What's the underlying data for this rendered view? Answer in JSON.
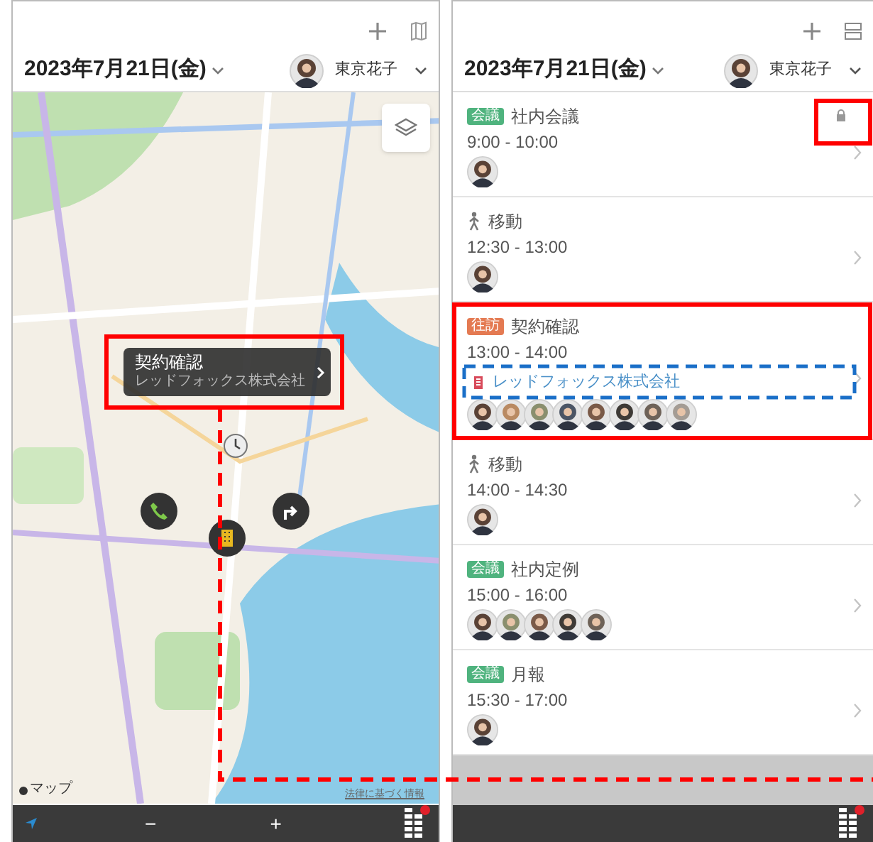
{
  "map_screen": {
    "date": "2023年7月21日(金)",
    "user": "東京花子",
    "map": {
      "kind": "picture",
      "callout": {
        "title": "契約確認",
        "subtitle": "レッドフォックス株式会社"
      },
      "attribution": "マップ",
      "legal_link": "法律に基づく情報"
    },
    "bottom_bar": {
      "zoom_out": "−",
      "zoom_in": "+",
      "notification": true
    }
  },
  "list_screen": {
    "date": "2023年7月21日(金)",
    "user": "東京花子",
    "events": [
      {
        "kind": "tagged",
        "tag": {
          "label": "会議",
          "color": "#4fb37e"
        },
        "title": "社内会議",
        "time": "9:00 - 10:00",
        "locked": true,
        "attendees": [
          {
            "color": "#5a4236"
          }
        ]
      },
      {
        "kind": "travel",
        "title": "移動",
        "time": "12:30 - 13:00",
        "locked": false,
        "attendees": [
          {
            "color": "#5a4236"
          }
        ]
      },
      {
        "kind": "tagged",
        "tag": {
          "label": "往訪",
          "color": "#e47a52"
        },
        "title": "契約確認",
        "time": "13:00 - 14:00",
        "locked": false,
        "company": "レッドフォックス株式会社",
        "attendees": [
          {
            "color": "#5a4236"
          },
          {
            "color": "#b98a62"
          },
          {
            "color": "#8a8f6e"
          },
          {
            "color": "#4b5565"
          },
          {
            "color": "#7a5a48"
          },
          {
            "color": "#3e3a36"
          },
          {
            "color": "#6e6258"
          },
          {
            "color": "#a49c94"
          }
        ]
      },
      {
        "kind": "travel",
        "title": "移動",
        "time": "14:00 - 14:30",
        "locked": false,
        "attendees": [
          {
            "color": "#5a4236"
          }
        ]
      },
      {
        "kind": "tagged",
        "tag": {
          "label": "会議",
          "color": "#4fb37e"
        },
        "title": "社内定例",
        "time": "15:00 - 16:00",
        "locked": false,
        "attendees": [
          {
            "color": "#5a4236"
          },
          {
            "color": "#8a8f6e"
          },
          {
            "color": "#7a5a48"
          },
          {
            "color": "#3e3a36"
          },
          {
            "color": "#6e6258"
          }
        ]
      },
      {
        "kind": "tagged",
        "tag": {
          "label": "会議",
          "color": "#4fb37e"
        },
        "title": "月報",
        "time": "15:30 - 17:00",
        "locked": false,
        "attendees": [
          {
            "color": "#5a4236"
          }
        ]
      }
    ],
    "bottom_bar": {
      "notification": true
    }
  }
}
